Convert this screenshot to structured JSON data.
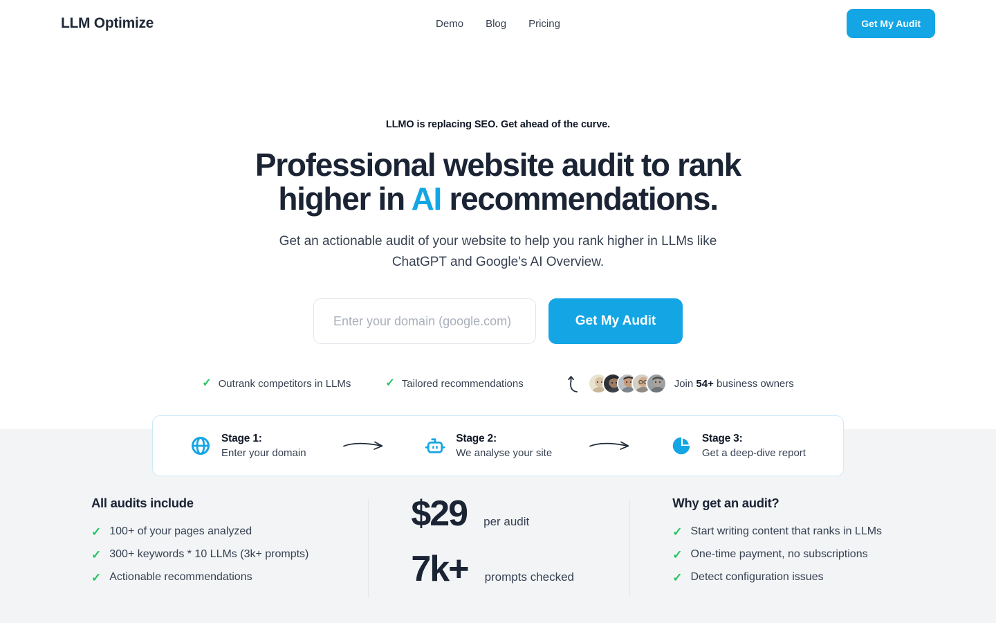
{
  "header": {
    "logo": "LLM Optimize",
    "nav": [
      {
        "label": "Demo"
      },
      {
        "label": "Blog"
      },
      {
        "label": "Pricing"
      }
    ],
    "cta_label": "Get My Audit"
  },
  "hero": {
    "eyebrow": "LLMO is replacing SEO. Get ahead of the curve.",
    "headline_line1": "Professional website audit to rank",
    "headline_line2_pre": "higher in ",
    "headline_highlight": "AI",
    "headline_line2_post": " recommendations.",
    "subhead": "Get an actionable audit of your website to help you rank higher in LLMs like ChatGPT and Google's AI Overview.",
    "input_placeholder": "Enter your domain (google.com)",
    "input_value": "",
    "submit_label": "Get My Audit",
    "trust": [
      {
        "icon": "check-icon",
        "label": "Outrank competitors in LLMs"
      },
      {
        "icon": "check-icon",
        "label": "Tailored recommendations"
      }
    ],
    "social_proof": {
      "arrow_icon": "curved-up-arrow-icon",
      "prefix": "Join ",
      "count": "54+",
      "suffix": " business owners",
      "avatar_count": 5
    }
  },
  "stages": [
    {
      "icon": "globe-icon",
      "title": "Stage 1:",
      "subtitle": "Enter your domain"
    },
    {
      "icon": "robot-icon",
      "title": "Stage 2:",
      "subtitle": "We analyse your site"
    },
    {
      "icon": "pie-chart-icon",
      "title": "Stage 3:",
      "subtitle": "Get a deep-dive report"
    }
  ],
  "bottom": {
    "includes": {
      "title": "All audits include",
      "items": [
        "100+ of your pages analyzed",
        "300+ keywords * 10 LLMs (3k+ prompts)",
        "Actionable recommendations"
      ]
    },
    "stats": [
      {
        "value": "$29",
        "label": "per audit"
      },
      {
        "value": "7k+",
        "label": "prompts checked"
      }
    ],
    "why": {
      "title": "Why get an audit?",
      "items": [
        "Start writing content that ranks in LLMs",
        "One-time payment, no subscriptions",
        "Detect configuration issues"
      ]
    }
  },
  "colors": {
    "accent_blue": "#14a5e4",
    "check_green": "#22c55e",
    "section_gray": "#f2f4f6",
    "text_dark": "#1b2434"
  }
}
